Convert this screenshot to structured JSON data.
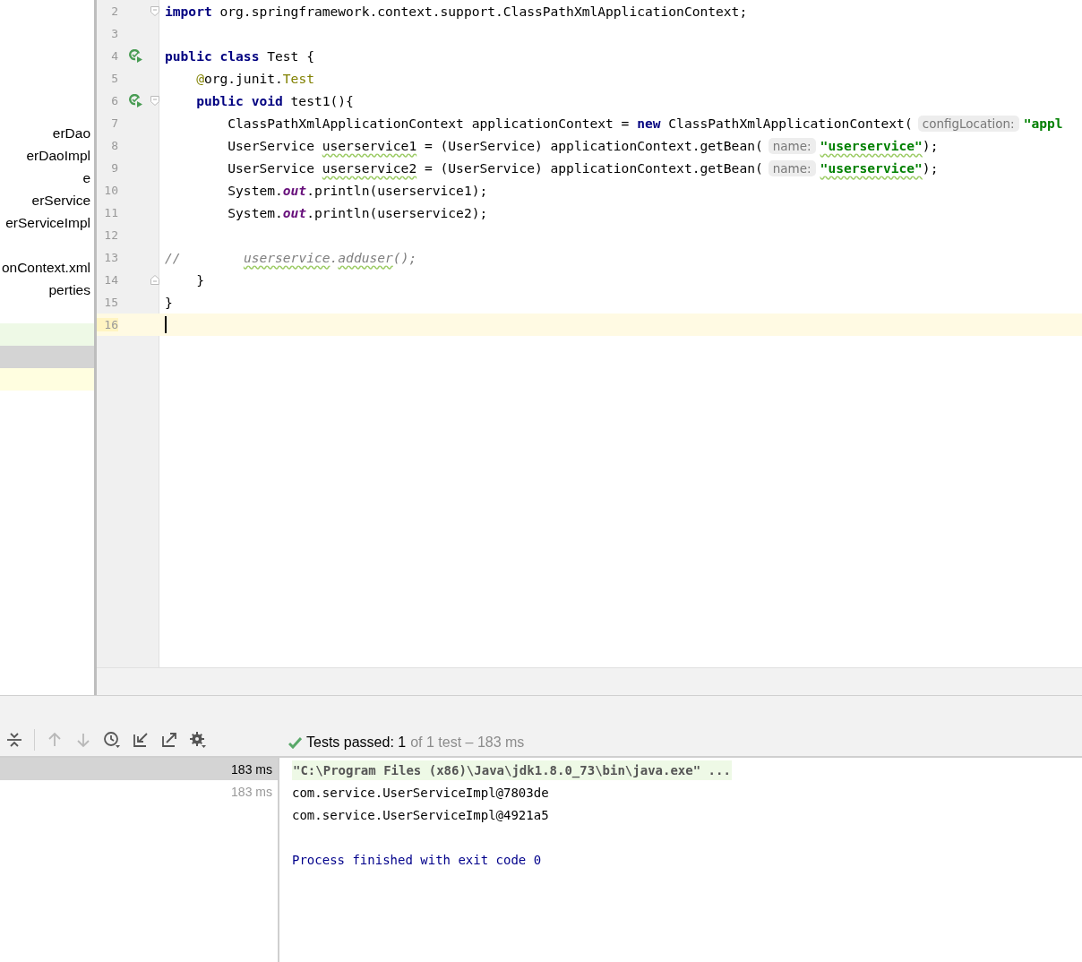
{
  "sidebar": {
    "groups": [
      [
        {
          "label": "erDao"
        },
        {
          "label": "erDaoImpl"
        },
        {
          "label": "e"
        },
        {
          "label": "erService"
        },
        {
          "label": "erServiceImpl"
        }
      ],
      [
        {
          "label": "onContext.xml"
        },
        {
          "label": "perties"
        }
      ]
    ],
    "highlight_rows": [
      {
        "color": "#eef9e6"
      },
      {
        "color": "#d4d4d4"
      },
      {
        "color": "#fffee0"
      }
    ]
  },
  "editor": {
    "lines": [
      {
        "number": "2",
        "current": false,
        "gutter_icons": [
          {
            "kind": "fold-start"
          }
        ],
        "tokens": [
          {
            "kind": "kw",
            "text": "import"
          },
          {
            "kind": "text",
            "text": " org.springframework.context.support.ClassPathXmlApplicationContext;"
          }
        ]
      },
      {
        "number": "3",
        "current": false
      },
      {
        "number": "4",
        "current": false,
        "gutter_icons": [
          {
            "kind": "run"
          }
        ],
        "tokens": [
          {
            "kind": "kw",
            "text": "public class"
          },
          {
            "kind": "text",
            "text": " Test {"
          }
        ]
      },
      {
        "number": "5",
        "current": false,
        "tokens": [
          {
            "kind": "annot",
            "text": "    @"
          },
          {
            "kind": "text",
            "text": "org.junit."
          },
          {
            "kind": "annot",
            "text": "Test"
          }
        ]
      },
      {
        "number": "6",
        "current": false,
        "gutter_icons": [
          {
            "kind": "run"
          },
          {
            "kind": "fold-start"
          }
        ],
        "tokens": [
          {
            "kind": "kw",
            "text": "    public void"
          },
          {
            "kind": "text",
            "text": " test1(){"
          }
        ]
      },
      {
        "number": "7",
        "current": false,
        "tokens": [
          {
            "kind": "text",
            "text": "        ClassPathXmlApplicationContext applicationContext = "
          },
          {
            "kind": "kw",
            "text": "new"
          },
          {
            "kind": "text",
            "text": " ClassPathXmlApplicationContext("
          },
          {
            "kind": "hint",
            "text": "configLocation:"
          },
          {
            "kind": "str",
            "text": "\"appl"
          }
        ]
      },
      {
        "number": "8",
        "current": false,
        "tokens": [
          {
            "kind": "text",
            "text": "        UserService "
          },
          {
            "kind": "warn",
            "text": "userservice1"
          },
          {
            "kind": "text",
            "text": " = (UserService) applicationContext.getBean("
          },
          {
            "kind": "hint",
            "text": "name:"
          },
          {
            "kind": "str-warn",
            "text": "\"userservice\""
          },
          {
            "kind": "text",
            "text": ");"
          }
        ]
      },
      {
        "number": "9",
        "current": false,
        "tokens": [
          {
            "kind": "text",
            "text": "        UserService "
          },
          {
            "kind": "warn",
            "text": "userservice2"
          },
          {
            "kind": "text",
            "text": " = (UserService) applicationContext.getBean("
          },
          {
            "kind": "hint",
            "text": "name:"
          },
          {
            "kind": "str-warn",
            "text": "\"userservice\""
          },
          {
            "kind": "text",
            "text": ");"
          }
        ]
      },
      {
        "number": "10",
        "current": false,
        "tokens": [
          {
            "kind": "text",
            "text": "        System."
          },
          {
            "kind": "field",
            "text": "out"
          },
          {
            "kind": "text",
            "text": ".println(userservice1);"
          }
        ]
      },
      {
        "number": "11",
        "current": false,
        "tokens": [
          {
            "kind": "text",
            "text": "        System."
          },
          {
            "kind": "field",
            "text": "out"
          },
          {
            "kind": "text",
            "text": ".println(userservice2);"
          }
        ]
      },
      {
        "number": "12",
        "current": false
      },
      {
        "number": "13",
        "current": false,
        "tokens": [
          {
            "kind": "comment",
            "text": "//        "
          },
          {
            "kind": "comment-warn",
            "text": "userservice"
          },
          {
            "kind": "comment",
            "text": "."
          },
          {
            "kind": "comment-warn",
            "text": "adduser"
          },
          {
            "kind": "comment",
            "text": "();"
          }
        ]
      },
      {
        "number": "14",
        "current": false,
        "gutter_icons": [
          {
            "kind": "fold-end"
          }
        ],
        "tokens": [
          {
            "kind": "text",
            "text": "    }"
          }
        ]
      },
      {
        "number": "15",
        "current": false,
        "tokens": [
          {
            "kind": "text",
            "text": "}"
          }
        ]
      },
      {
        "number": "16",
        "current": true
      }
    ]
  },
  "run_panel": {
    "toolbar": [
      {
        "kind": "collapse",
        "disabled": false
      },
      {
        "kind": "up",
        "disabled": true
      },
      {
        "kind": "down",
        "disabled": true
      },
      {
        "kind": "history",
        "disabled": false
      },
      {
        "kind": "import",
        "disabled": false
      },
      {
        "kind": "export",
        "disabled": false
      },
      {
        "kind": "settings",
        "disabled": false
      }
    ],
    "status": {
      "passed": "Tests passed: 1",
      "detail": "of 1 test – 183 ms"
    },
    "tests": [
      {
        "time": "183 ms",
        "selected": true
      },
      {
        "time": "183 ms",
        "selected": false
      }
    ],
    "console": [
      {
        "kind": "command",
        "text": "\"C:\\Program Files (x86)\\Java\\jdk1.8.0_73\\bin\\java.exe\" ..."
      },
      {
        "kind": "output",
        "text": "com.service.UserServiceImpl@7803de"
      },
      {
        "kind": "output",
        "text": "com.service.UserServiceImpl@4921a5"
      },
      {
        "kind": "blank"
      },
      {
        "kind": "system",
        "text": "Process finished with exit code 0"
      }
    ]
  }
}
